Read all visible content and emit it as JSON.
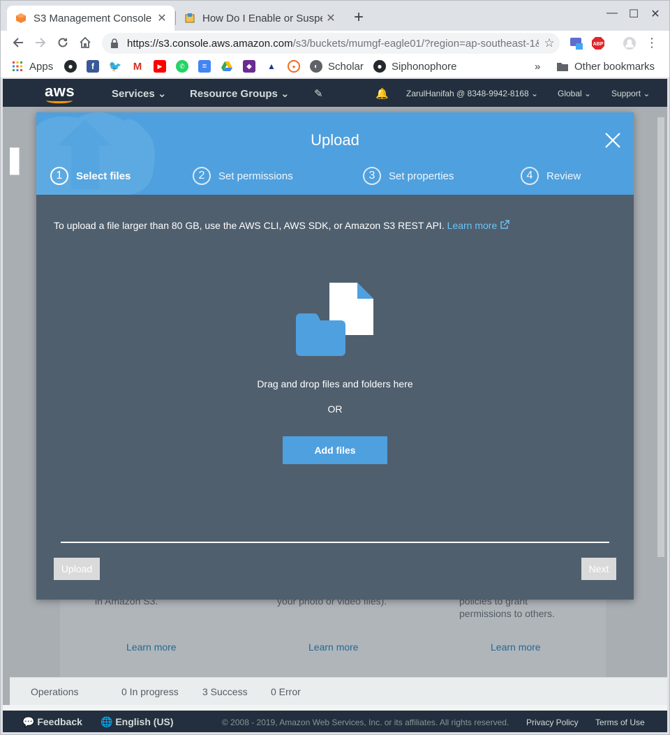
{
  "browser": {
    "tabs": [
      {
        "title": "S3 Management Console",
        "active": true
      },
      {
        "title": "How Do I Enable or Suspe",
        "active": false
      }
    ],
    "url_host": "https://s3.console.aws.amazon.com",
    "url_rest": "/s3/buckets/mumgf-eagle01/?region=ap-southeast-1&t...",
    "bookmarks": {
      "apps": "Apps",
      "scholar": "Scholar",
      "siphonophore": "Siphonophore",
      "overflow": "»",
      "other": "Other bookmarks"
    }
  },
  "aws_nav": {
    "logo": "aws",
    "services": "Services",
    "resource_groups": "Resource Groups",
    "account": "ZarulHanifah @ 8348-9942-8168",
    "region": "Global",
    "support": "Support"
  },
  "background": {
    "col1_text": "in Amazon S3.",
    "col2_text": "your photo or video files).",
    "col3_line1": "policies to grant",
    "col3_line2": "permissions to others.",
    "learn_more": "Learn more"
  },
  "operations": {
    "label": "Operations",
    "in_progress": "0 In progress",
    "success": "3 Success",
    "error": "0 Error"
  },
  "footer": {
    "feedback": "Feedback",
    "language": "English (US)",
    "copyright": "© 2008 - 2019, Amazon Web Services, Inc. or its affiliates. All rights reserved.",
    "privacy": "Privacy Policy",
    "terms": "Terms of Use"
  },
  "modal": {
    "title": "Upload",
    "steps": [
      {
        "num": "1",
        "label": "Select files"
      },
      {
        "num": "2",
        "label": "Set permissions"
      },
      {
        "num": "3",
        "label": "Set properties"
      },
      {
        "num": "4",
        "label": "Review"
      }
    ],
    "active_step": 1,
    "info_text": "To upload a file larger than 80 GB, use the AWS CLI, AWS SDK, or Amazon S3 REST API.",
    "info_link": "Learn more",
    "drag_text": "Drag and drop files and folders here",
    "or_text": "OR",
    "add_files": "Add files",
    "upload_button": "Upload",
    "next_button": "Next"
  },
  "colors": {
    "modal_header": "#4fa0de",
    "modal_body": "#4f5f6e",
    "aws_nav": "#232f3e",
    "link": "#6cc4f8",
    "aws_orange": "#ff9900"
  }
}
